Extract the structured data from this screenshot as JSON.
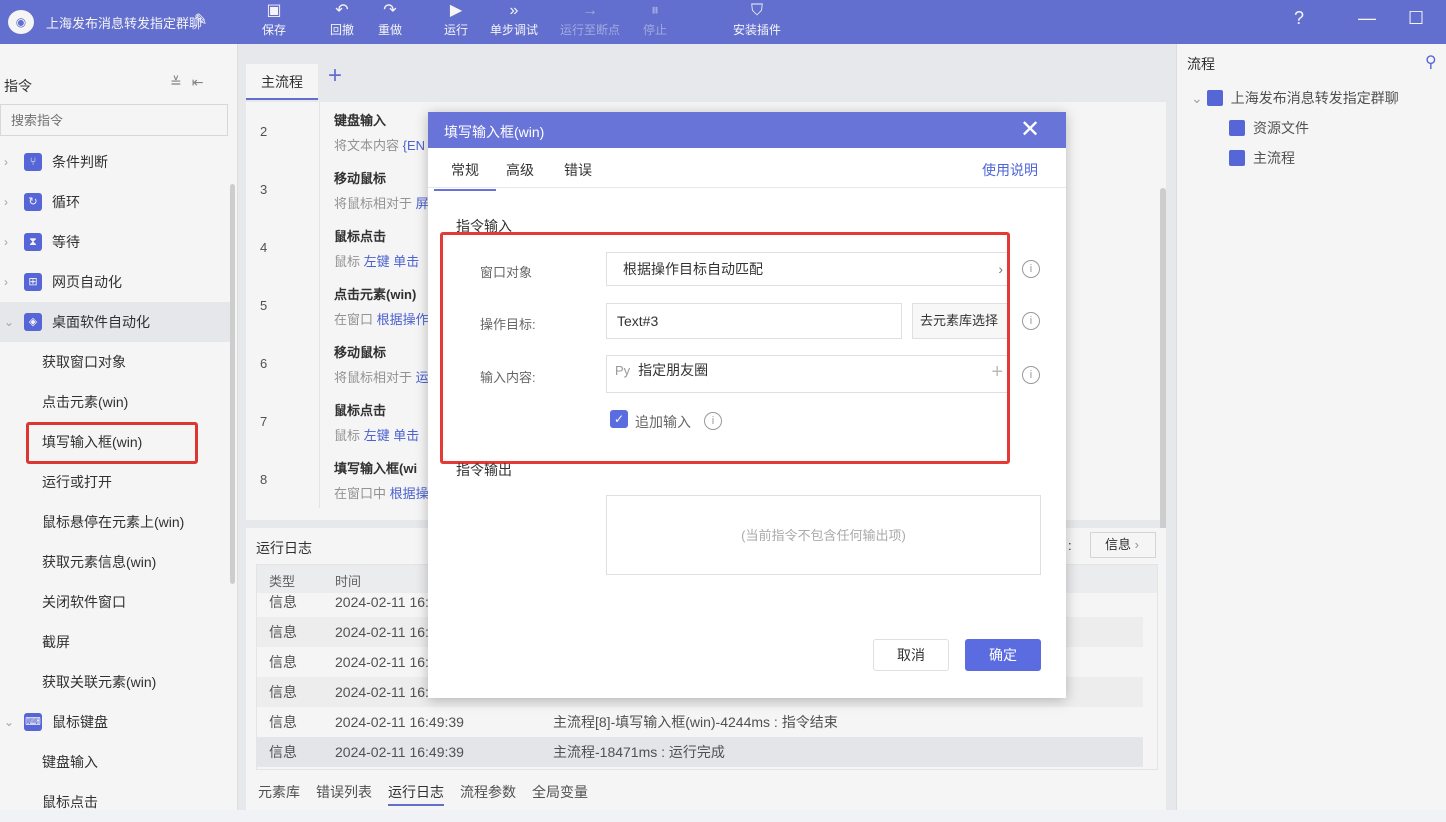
{
  "app": {
    "title": "上海发布消息转发指定群聊",
    "logo_icon": "app-logo-icon",
    "accent": "#6874d8"
  },
  "toolbar": {
    "items": [
      {
        "label": "保存",
        "icon": "save-icon",
        "enabled": true
      },
      {
        "label": "回撤",
        "icon": "undo-icon",
        "enabled": true
      },
      {
        "label": "重做",
        "icon": "redo-icon",
        "enabled": true
      },
      {
        "label": "运行",
        "icon": "play-icon",
        "enabled": true
      },
      {
        "label": "单步调试",
        "icon": "step-debug-icon",
        "enabled": true
      },
      {
        "label": "运行至断点",
        "icon": "run-to-breakpoint-icon",
        "enabled": false
      },
      {
        "label": "停止",
        "icon": "stop-icon",
        "enabled": false
      },
      {
        "label": "安装插件",
        "icon": "plugin-icon",
        "enabled": true
      }
    ]
  },
  "left": {
    "header": "指令",
    "search_placeholder": "搜索指令",
    "categories": [
      {
        "label": "条件判断",
        "icon": "condition-icon"
      },
      {
        "label": "循环",
        "icon": "loop-icon"
      },
      {
        "label": "等待",
        "icon": "hourglass-icon"
      },
      {
        "label": "网页自动化",
        "icon": "web-automation-icon"
      },
      {
        "label": "桌面软件自动化",
        "icon": "desktop-automation-icon"
      },
      {
        "label": "鼠标键盘",
        "icon": "mouse-keyboard-icon"
      }
    ],
    "desktop_items": [
      "获取窗口对象",
      "点击元素(win)",
      "填写输入框(win)",
      "运行或打开",
      "鼠标悬停在元素上(win)",
      "获取元素信息(win)",
      "关闭软件窗口",
      "截屏",
      "获取关联元素(win)"
    ],
    "mouse_items": [
      "键盘输入",
      "鼠标点击"
    ]
  },
  "center": {
    "tab_main": "主流程",
    "rows": [
      {
        "num": "2",
        "name": "键盘输入",
        "desc_pre": "将文本内容 ",
        "desc_hl": "{EN"
      },
      {
        "num": "3",
        "name": "移动鼠标",
        "desc_pre": "将鼠标相对于 ",
        "desc_hl": "屏"
      },
      {
        "num": "4",
        "name": "鼠标点击",
        "desc_pre": "鼠标 ",
        "desc_hl": "左键 单击"
      },
      {
        "num": "5",
        "name": "点击元素(win)",
        "desc_pre": "在窗口 ",
        "desc_hl": "根据操作"
      },
      {
        "num": "6",
        "name": "移动鼠标",
        "desc_pre": "将鼠标相对于 ",
        "desc_hl": "运"
      },
      {
        "num": "7",
        "name": "鼠标点击",
        "desc_pre": "鼠标 ",
        "desc_hl": "左键 单击"
      },
      {
        "num": "8",
        "name": "填写输入框(wi",
        "desc_pre": "在窗口中 ",
        "desc_hl": "根据操"
      }
    ],
    "log": {
      "title": "运行日志",
      "level_label": "信息",
      "col_type": "类型",
      "col_time": "时间",
      "rows": [
        {
          "type": "信息",
          "time": "2024-02-11 16:",
          "msg": ""
        },
        {
          "type": "信息",
          "time": "2024-02-11 16:",
          "msg": ""
        },
        {
          "type": "信息",
          "time": "2024-02-11 16:",
          "msg": ""
        },
        {
          "type": "信息",
          "time": "2024-02-11 16:",
          "msg": ""
        },
        {
          "type": "信息",
          "time": "2024-02-11 16:49:39",
          "msg": "主流程[8]-填写输入框(win)-4244ms : 指令结束"
        },
        {
          "type": "信息",
          "time": "2024-02-11 16:49:39",
          "msg": "主流程-18471ms : 运行完成"
        }
      ]
    },
    "bottom_tabs": [
      "元素库",
      "错误列表",
      "运行日志",
      "流程参数",
      "全局变量"
    ]
  },
  "right": {
    "title": "流程",
    "tree": [
      "上海发布消息转发指定群聊",
      "资源文件",
      "主流程"
    ]
  },
  "modal": {
    "title": "填写输入框(win)",
    "tabs": [
      "常规",
      "高级",
      "错误"
    ],
    "help": "使用说明",
    "section_in": "指令输入",
    "window_label": "窗口对象",
    "window_value": "根据操作目标自动匹配",
    "target_label": "操作目标:",
    "target_value": "Text#3",
    "target_button": "去元素库选择",
    "content_label": "输入内容:",
    "content_prefix": "Py",
    "content_value": "指定朋友圈",
    "append_label": "追加输入",
    "append_checked": true,
    "section_out": "指令输出",
    "output_empty": "(当前指令不包含任何输出项)",
    "cancel": "取消",
    "ok": "确定"
  }
}
